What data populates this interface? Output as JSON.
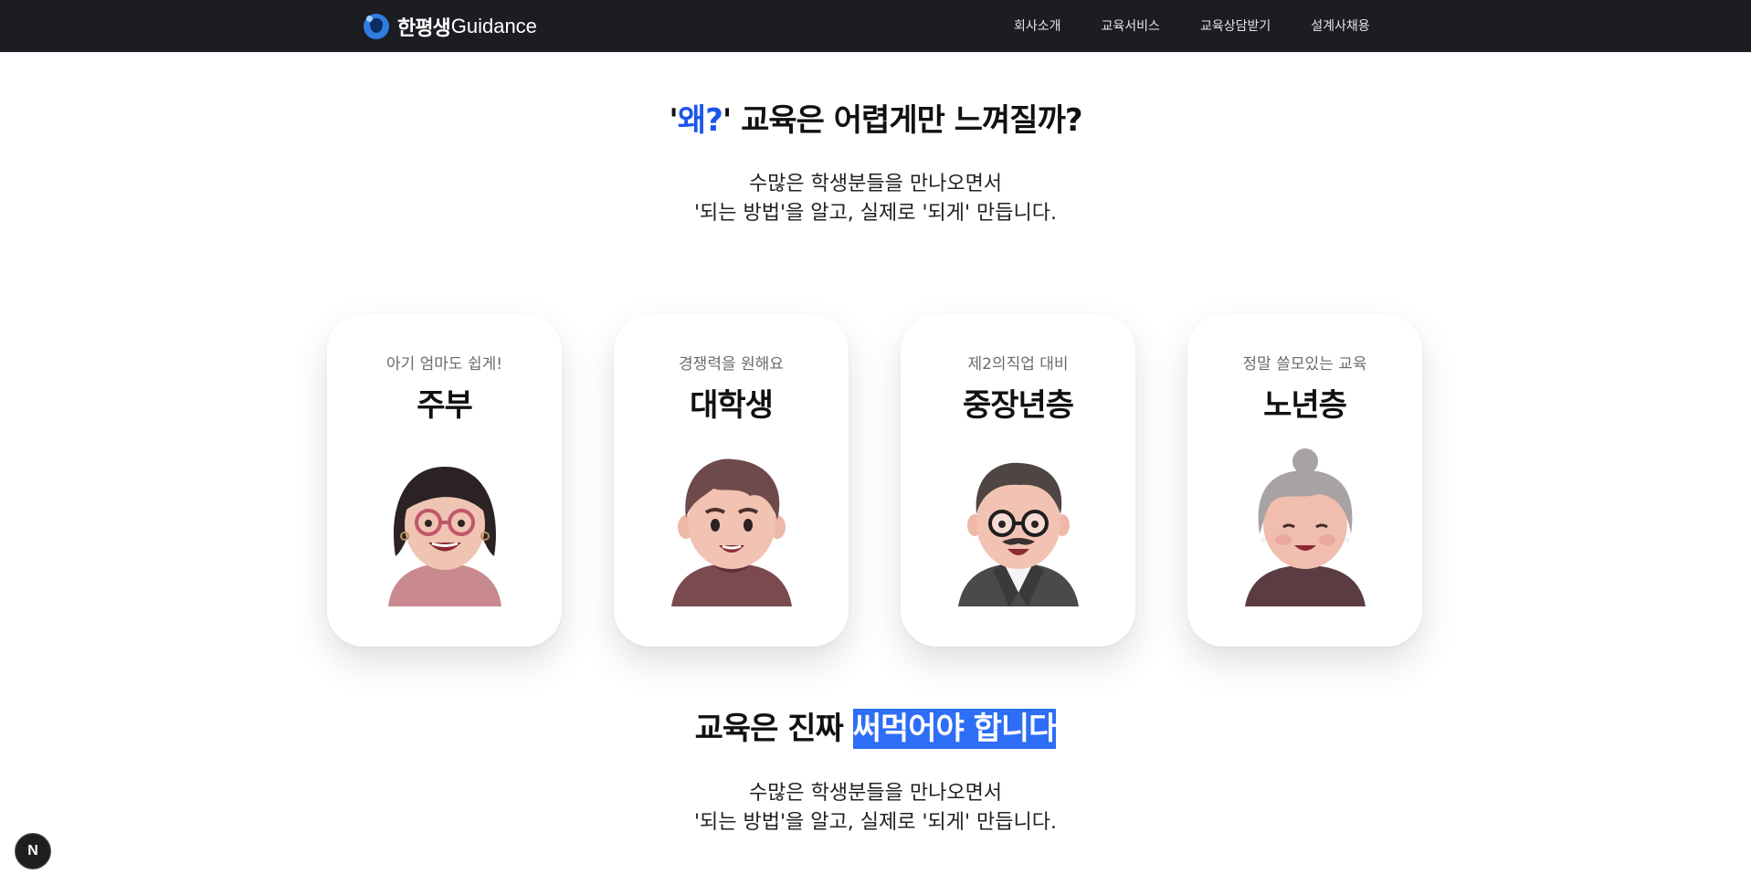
{
  "nav": {
    "brand_kr": "한평생",
    "brand_en": "Guidance",
    "links": [
      "회사소개",
      "교육서비스",
      "교육상담받기",
      "설계사채용"
    ]
  },
  "hero": {
    "title_quote_open": "'",
    "title_accent": "왜?",
    "title_rest": "' 교육은 어렵게만 느껴질까?",
    "sub_line1": "수많은 학생분들을 만나오면서",
    "sub_line2": "'되는 방법'을 알고, 실제로 '되게' 만듭니다."
  },
  "cards": [
    {
      "small": "아기 엄마도 쉽게!",
      "big": "주부",
      "avatar": "woman-glasses-avatar"
    },
    {
      "small": "경쟁력을 원해요",
      "big": "대학생",
      "avatar": "student-avatar"
    },
    {
      "small": "제2의직업 대비",
      "big": "중장년층",
      "avatar": "middle-aged-man-avatar"
    },
    {
      "small": "정말 쓸모있는 교육",
      "big": "노년층",
      "avatar": "elderly-woman-avatar"
    }
  ],
  "section2": {
    "title_plain": "교육은 진짜 ",
    "title_highlight": "써먹어야 합니다",
    "sub_line1": "수많은 학생분들을 만나오면서",
    "sub_line2": "'되는 방법'을 알고, 실제로 '되게' 만듭니다."
  },
  "badge": {
    "label": "N"
  },
  "colors": {
    "accent": "#1c55ea",
    "highlight": "#2e6df6",
    "topbar": "#1b1d22"
  }
}
